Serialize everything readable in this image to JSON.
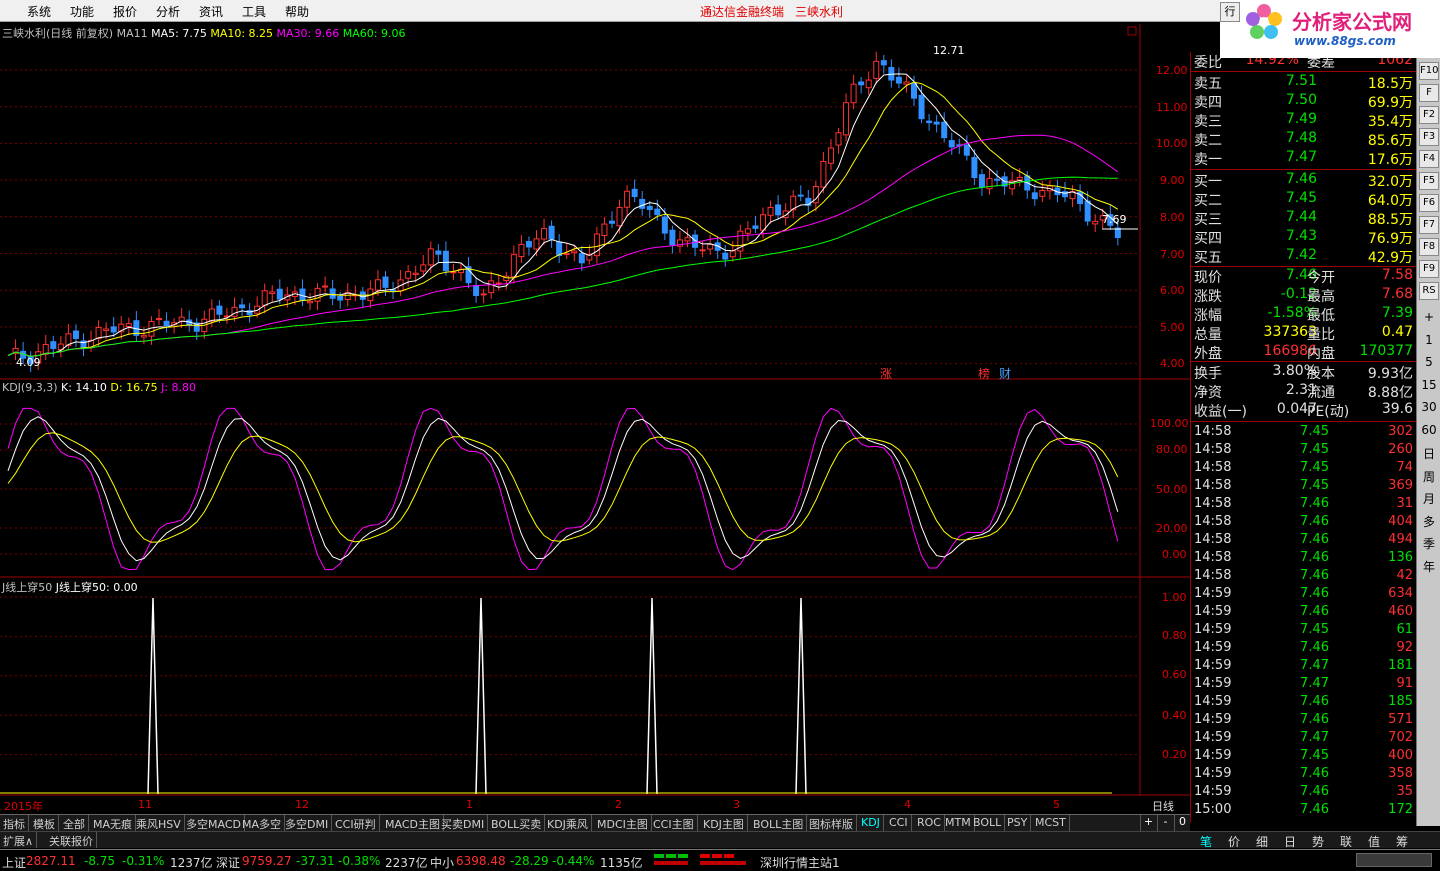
{
  "menu": {
    "items": [
      "系统",
      "功能",
      "报价",
      "分析",
      "资讯",
      "工具",
      "帮助"
    ],
    "app_title": "通达信金融终端",
    "stock_title": "三峡水利"
  },
  "logo": {
    "brand": "分析家公式网",
    "url": "www.88gs.com",
    "tab_label": "行"
  },
  "main_chart": {
    "header_name": "三峡水利(日线 前复权)",
    "ma_label": "MA11",
    "ma5": "MA5: 7.75",
    "ma10": "MA10: 8.25",
    "ma30": "MA30: 9.66",
    "ma60": "MA60: 9.06",
    "high_label": "12.71",
    "low_label": "4.09",
    "last_label": "7.69",
    "marker_zhang": "涨",
    "marker_bang": "榜",
    "marker_cai": "财",
    "y_ticks": [
      "12.00",
      "11.00",
      "10.00",
      "9.00",
      "8.00",
      "7.00",
      "6.00",
      "5.00",
      "4.00"
    ],
    "colors": {
      "ma5": "#ffffff",
      "ma10": "#ffff00",
      "ma30": "#ff00ff",
      "ma60": "#00ff00",
      "up": "#ff3030",
      "down": "#3090ff"
    }
  },
  "kdj_panel": {
    "header_name": "KDJ(9,3,3)",
    "k": "K: 14.10",
    "d": "D: 16.75",
    "j": "J: 8.80",
    "y_ticks": [
      "100.00",
      "80.00",
      "50.00",
      "20.00",
      "0.00"
    ]
  },
  "j_panel": {
    "header_a": "J线上穿50",
    "header_b": "J线上穿50: 0.00",
    "y_ticks": [
      "1.00",
      "0.80",
      "0.60",
      "0.40",
      "0.20"
    ]
  },
  "xaxis": {
    "labels": [
      "2015年",
      "11",
      "12",
      "1",
      "2",
      "3",
      "4",
      "5"
    ],
    "period": "日线"
  },
  "quote": {
    "webi": {
      "label": "委比",
      "value": "14.92%",
      "label2": "委差",
      "value2": "1062"
    },
    "sell": [
      {
        "label": "卖五",
        "price": "7.51",
        "vol": "18.5万"
      },
      {
        "label": "卖四",
        "price": "7.50",
        "vol": "69.9万"
      },
      {
        "label": "卖三",
        "price": "7.49",
        "vol": "35.4万"
      },
      {
        "label": "卖二",
        "price": "7.48",
        "vol": "85.6万"
      },
      {
        "label": "卖一",
        "price": "7.47",
        "vol": "17.6万"
      }
    ],
    "buy": [
      {
        "label": "买一",
        "price": "7.46",
        "vol": "32.0万"
      },
      {
        "label": "买二",
        "price": "7.45",
        "vol": "64.0万"
      },
      {
        "label": "买三",
        "price": "7.44",
        "vol": "88.5万"
      },
      {
        "label": "买四",
        "price": "7.43",
        "vol": "76.9万"
      },
      {
        "label": "买五",
        "price": "7.42",
        "vol": "42.9万"
      }
    ],
    "stats": [
      {
        "l1": "现价",
        "v1": "7.46",
        "l2": "今开",
        "v2": "7.58"
      },
      {
        "l1": "涨跌",
        "v1": "-0.12",
        "l2": "最高",
        "v2": "7.68"
      },
      {
        "l1": "涨幅",
        "v1": "-1.58%",
        "l2": "最低",
        "v2": "7.39"
      },
      {
        "l1": "总量",
        "v1": "337363",
        "l2": "量比",
        "v2": "0.47"
      },
      {
        "l1": "外盘",
        "v1": "166986",
        "l2": "内盘",
        "v2": "170377"
      }
    ],
    "fund": [
      {
        "l1": "换手",
        "v1": "3.80%",
        "l2": "股本",
        "v2": "9.93亿"
      },
      {
        "l1": "净资",
        "v1": "2.31",
        "l2": "流通",
        "v2": "8.88亿"
      },
      {
        "l1": "收益(一)",
        "v1": "0.047",
        "l2": "PE(动)",
        "v2": "39.6"
      }
    ],
    "ticks": [
      {
        "t": "14:58",
        "p": "7.45",
        "v": "302"
      },
      {
        "t": "14:58",
        "p": "7.45",
        "v": "260"
      },
      {
        "t": "14:58",
        "p": "7.45",
        "v": "74"
      },
      {
        "t": "14:58",
        "p": "7.45",
        "v": "369"
      },
      {
        "t": "14:58",
        "p": "7.46",
        "v": "31"
      },
      {
        "t": "14:58",
        "p": "7.46",
        "v": "404"
      },
      {
        "t": "14:58",
        "p": "7.46",
        "v": "494"
      },
      {
        "t": "14:58",
        "p": "7.46",
        "v": "136"
      },
      {
        "t": "14:58",
        "p": "7.46",
        "v": "42"
      },
      {
        "t": "14:59",
        "p": "7.46",
        "v": "634"
      },
      {
        "t": "14:59",
        "p": "7.46",
        "v": "460"
      },
      {
        "t": "14:59",
        "p": "7.45",
        "v": "61"
      },
      {
        "t": "14:59",
        "p": "7.46",
        "v": "92"
      },
      {
        "t": "14:59",
        "p": "7.47",
        "v": "181"
      },
      {
        "t": "14:59",
        "p": "7.47",
        "v": "91"
      },
      {
        "t": "14:59",
        "p": "7.46",
        "v": "185"
      },
      {
        "t": "14:59",
        "p": "7.46",
        "v": "571"
      },
      {
        "t": "14:59",
        "p": "7.47",
        "v": "702"
      },
      {
        "t": "14:59",
        "p": "7.45",
        "v": "400"
      },
      {
        "t": "14:59",
        "p": "7.46",
        "v": "358"
      },
      {
        "t": "14:59",
        "p": "7.46",
        "v": "35"
      },
      {
        "t": "15:00",
        "p": "7.46",
        "v": "172"
      }
    ]
  },
  "iconbar": [
    "F10",
    "F",
    "F2",
    "F3",
    "F4",
    "F5",
    "F6",
    "F7",
    "F8",
    "F9",
    "RS",
    "+",
    "1",
    "5",
    "15",
    "30",
    "60",
    "日",
    "周",
    "月",
    "多",
    "季",
    "年"
  ],
  "tabs": [
    "指标",
    "模板",
    "全部",
    "MA无痕",
    "乘风HSV",
    "多空MACD",
    "MA多空",
    "多空DMI",
    "CCI研判",
    "MACD主图",
    "买卖DMI",
    "BOLL买卖",
    "KDJ乘风",
    "MDCI主图",
    "CCI主图",
    "KDJ主图",
    "BOLL主图",
    "图标样版",
    "KDJ",
    "CCI",
    "ROC",
    "MTM",
    "BOLL",
    "PSY",
    "MCST"
  ],
  "tabs_active": "KDJ",
  "zoom_buttons": [
    "+",
    "-",
    "0"
  ],
  "subtabs": [
    "扩展∧",
    "关联报价"
  ],
  "quote_tabs": [
    "笔",
    "价",
    "细",
    "日",
    "势",
    "联",
    "值",
    "筹"
  ],
  "status": {
    "sh_label": "上证",
    "sh_val": "2827.11",
    "sh_chg": "-8.75",
    "sh_pct": "-0.31%",
    "sh_amt": "1237亿",
    "sz_label": "深证",
    "sz_val": "9759.27",
    "sz_chg": "-37.31",
    "sz_pct": "-0.38%",
    "sz_amt": "2237亿",
    "zx_label": "中小",
    "zx_val": "6398.48",
    "zx_chg": "-28.29",
    "zx_pct": "-0.44%",
    "zx_amt": "1135亿",
    "server": "深圳行情主站1"
  }
}
